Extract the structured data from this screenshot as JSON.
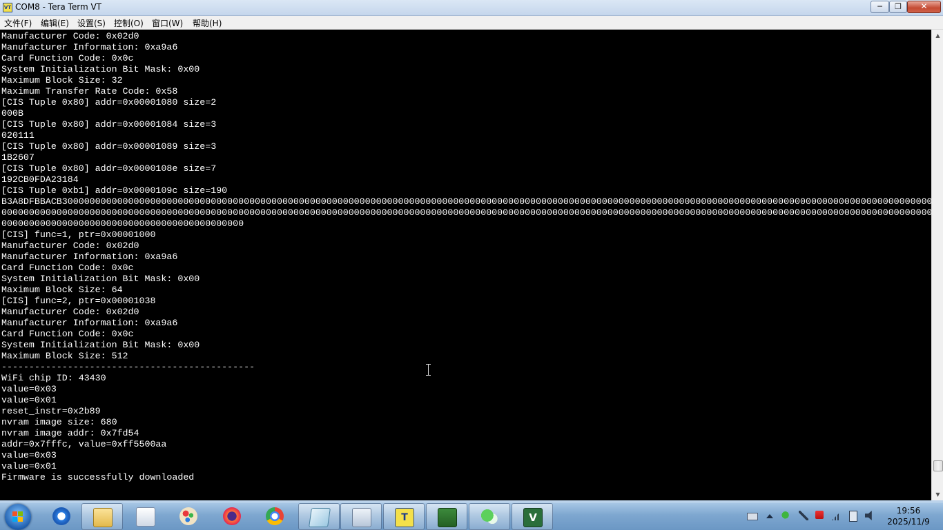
{
  "window": {
    "title": "COM8 - Tera Term VT",
    "icon": "tera-term-icon",
    "controls": {
      "minimize": "─",
      "maximize": "❐",
      "close": "✕"
    }
  },
  "menu": {
    "items": [
      {
        "label": "文件(F)"
      },
      {
        "label": "编辑(E)"
      },
      {
        "label": "设置(S)"
      },
      {
        "label": "控制(O)"
      },
      {
        "label": "窗口(W)"
      },
      {
        "label": "帮助(H)"
      }
    ]
  },
  "terminal": {
    "background": "#000000",
    "foreground": "#ffffff",
    "lines": [
      "Manufacturer Code: 0x02d0",
      "Manufacturer Information: 0xa9a6",
      "Card Function Code: 0x0c",
      "System Initialization Bit Mask: 0x00",
      "Maximum Block Size: 32",
      "Maximum Transfer Rate Code: 0x58",
      "[CIS Tuple 0x80] addr=0x00001080 size=2",
      "000B",
      "[CIS Tuple 0x80] addr=0x00001084 size=3",
      "020111",
      "[CIS Tuple 0x80] addr=0x00001089 size=3",
      "1B2607",
      "[CIS Tuple 0x80] addr=0x0000108e size=7",
      "192CB0FDA23184",
      "[CIS Tuple 0xb1] addr=0x0000109c size=190",
      "B3A8DFBBACB3000000000000000000000000000000000000000000000000000000000000000000000000000000000000000000000000000000000000000000000000000000000000000000000000000000000000000",
      "0000000000000000000000000000000000000000000000000000000000000000000000000000000000000000000000000000000000000000000000000000000000000000000000000000000000000000000000000000",
      "00000000000000000000000000000000000000000000",
      "[CIS] func=1, ptr=0x00001000",
      "Manufacturer Code: 0x02d0",
      "Manufacturer Information: 0xa9a6",
      "Card Function Code: 0x0c",
      "System Initialization Bit Mask: 0x00",
      "Maximum Block Size: 64",
      "[CIS] func=2, ptr=0x00001038",
      "Manufacturer Code: 0x02d0",
      "Manufacturer Information: 0xa9a6",
      "Card Function Code: 0x0c",
      "System Initialization Bit Mask: 0x00",
      "Maximum Block Size: 512",
      "----------------------------------------------",
      "WiFi chip ID: 43430",
      "value=0x03",
      "value=0x01",
      "reset_instr=0x2b89",
      "nvram image size: 680",
      "nvram image addr: 0x7fd54",
      "addr=0x7fffc, value=0xff5500aa",
      "value=0x03",
      "value=0x01",
      "Firmware is successfully downloaded"
    ]
  },
  "scrollbar": {
    "position": 0.96
  },
  "taskbar": {
    "start_icon": "windows-start-icon",
    "apps": [
      {
        "name": "internet-explorer-icon",
        "active": false
      },
      {
        "name": "file-explorer-icon",
        "active": true
      },
      {
        "name": "media-player-icon",
        "active": false
      },
      {
        "name": "paint-icon",
        "active": false
      },
      {
        "name": "firefox-icon",
        "active": false
      },
      {
        "name": "chrome-icon",
        "active": false
      },
      {
        "name": "notepad-icon",
        "active": true
      },
      {
        "name": "calculator-icon",
        "active": true
      },
      {
        "name": "tera-term-icon",
        "active": true,
        "glyph": "T"
      },
      {
        "name": "editor-icon",
        "active": true
      },
      {
        "name": "wechat-icon",
        "active": true
      },
      {
        "name": "visual-studio-icon",
        "active": true,
        "glyph": "V"
      }
    ],
    "tray": [
      "keyboard-icon",
      "show-hidden-icons-arrow",
      "wechat-tray-icon",
      "pin-icon",
      "network-error-icon",
      "signal-icon",
      "battery-icon",
      "volume-icon"
    ],
    "clock": {
      "time": "19:56",
      "date": "2025/11/9"
    }
  }
}
